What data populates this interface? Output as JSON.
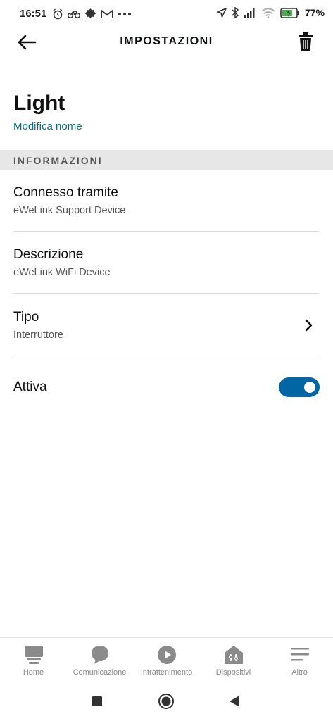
{
  "status_bar": {
    "time": "16:51",
    "left_icons": [
      "alarm-icon",
      "bike-icon",
      "settings-gear-icon",
      "gmail-icon",
      "more-dots-icon"
    ],
    "right_icons": [
      "location-icon",
      "bluetooth-icon",
      "signal-icon",
      "wifi-icon",
      "battery-charging-icon"
    ],
    "battery_text": "77%",
    "battery_level": 0.77
  },
  "header": {
    "title": "IMPOSTAZIONI",
    "back_icon": "arrow-left-icon",
    "delete_icon": "trash-icon"
  },
  "device": {
    "name": "Light",
    "rename_link": "Modifica nome"
  },
  "section": {
    "title": "INFORMAZIONI"
  },
  "rows": [
    {
      "title": "Connesso tramite",
      "subtitle": "eWeLink Support Device"
    },
    {
      "title": "Descrizione",
      "subtitle": "eWeLink WiFi Device"
    },
    {
      "title": "Tipo",
      "subtitle": "Interruttore"
    },
    {
      "title": "Attiva",
      "toggle_on": true
    }
  ],
  "bottom_nav": [
    {
      "label": "Home",
      "icon": "home-icon"
    },
    {
      "label": "Comunicazione",
      "icon": "chat-bubble-icon"
    },
    {
      "label": "Intrattenimento",
      "icon": "play-icon"
    },
    {
      "label": "Dispositivi",
      "icon": "devices-icon"
    },
    {
      "label": "Altro",
      "icon": "menu-icon"
    }
  ],
  "colors": {
    "accent": "#007185",
    "toggle": "#0066a4",
    "section_bg": "#e7e7e7"
  }
}
